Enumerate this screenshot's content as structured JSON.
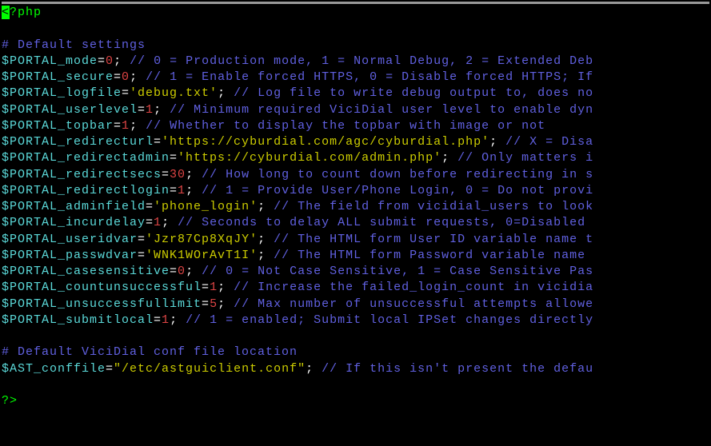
{
  "opening_cursor": "<",
  "opening_tag": "?php",
  "closing_tag": "?>",
  "comment_section1": "# Default settings",
  "comment_section2": "# Default ViciDial conf file location",
  "lines": [
    {
      "var": "$PORTAL_mode",
      "eq": "=",
      "val": "0",
      "semi": ";",
      "comment": " // 0 = Production mode, 1 = Normal Debug, 2 = Extended Deb"
    },
    {
      "var": "$PORTAL_secure",
      "eq": "=",
      "val": "0",
      "semi": ";",
      "comment": " // 1 = Enable forced HTTPS, 0 = Disable forced HTTPS; If"
    },
    {
      "var": "$PORTAL_logfile",
      "eq": "=",
      "str": "'debug.txt'",
      "semi": ";",
      "comment": " // Log file to write debug output to, does no"
    },
    {
      "var": "$PORTAL_userlevel",
      "eq": "=",
      "val": "1",
      "semi": ";",
      "comment": " // Minimum required ViciDial user level to enable dyn"
    },
    {
      "var": "$PORTAL_topbar",
      "eq": "=",
      "val": "1",
      "semi": ";",
      "comment": " // Whether to display the topbar with image or not"
    },
    {
      "var": "$PORTAL_redirecturl",
      "eq": "=",
      "str": "'https://cyburdial.com/agc/cyburdial.php'",
      "semi": ";",
      "comment": " // X = Disa"
    },
    {
      "var": "$PORTAL_redirectadmin",
      "eq": "=",
      "str": "'https://cyburdial.com/admin.php'",
      "semi": ";",
      "comment": " // Only matters i"
    },
    {
      "var": "$PORTAL_redirectsecs",
      "eq": "=",
      "val": "30",
      "semi": ";",
      "comment": " // How long to count down before redirecting in s"
    },
    {
      "var": "$PORTAL_redirectlogin",
      "eq": "=",
      "val": "1",
      "semi": ";",
      "comment": " // 1 = Provide User/Phone Login, 0 = Do not provi"
    },
    {
      "var": "$PORTAL_adminfield",
      "eq": "=",
      "str": "'phone_login'",
      "semi": ";",
      "comment": " // The field from vicidial_users to look"
    },
    {
      "var": "$PORTAL_incurdelay",
      "eq": "=",
      "val": "1",
      "semi": ";",
      "comment": " // Seconds to delay ALL submit requests, 0=Disabled "
    },
    {
      "var": "$PORTAL_useridvar",
      "eq": "=",
      "str": "'Jzr87Cp8XqJY'",
      "semi": ";",
      "comment": " // The HTML form User ID variable name t"
    },
    {
      "var": "$PORTAL_passwdvar",
      "eq": "=",
      "str": "'WNK1WOrAvT1I'",
      "semi": ";",
      "comment": " // The HTML form Password variable name "
    },
    {
      "var": "$PORTAL_casesensitive",
      "eq": "=",
      "val": "0",
      "semi": ";",
      "comment": " // 0 = Not Case Sensitive, 1 = Case Sensitive Pas"
    },
    {
      "var": "$PORTAL_countunsuccessful",
      "eq": "=",
      "val": "1",
      "semi": ";",
      "comment": " // Increase the failed_login_count in vicidia"
    },
    {
      "var": "$PORTAL_unsuccessfullimit",
      "eq": "=",
      "val": "5",
      "semi": ";",
      "comment": " // Max number of unsuccessful attempts allowe"
    },
    {
      "var": "$PORTAL_submitlocal",
      "eq": "=",
      "val": "1",
      "semi": ";",
      "comment": " // 1 = enabled; Submit local IPSet changes directly"
    }
  ],
  "conf_line": {
    "var": "$AST_conffile",
    "eq": "=",
    "str": "\"/etc/astguiclient.conf\"",
    "semi": ";",
    "comment": " // If this isn't present the defau"
  }
}
